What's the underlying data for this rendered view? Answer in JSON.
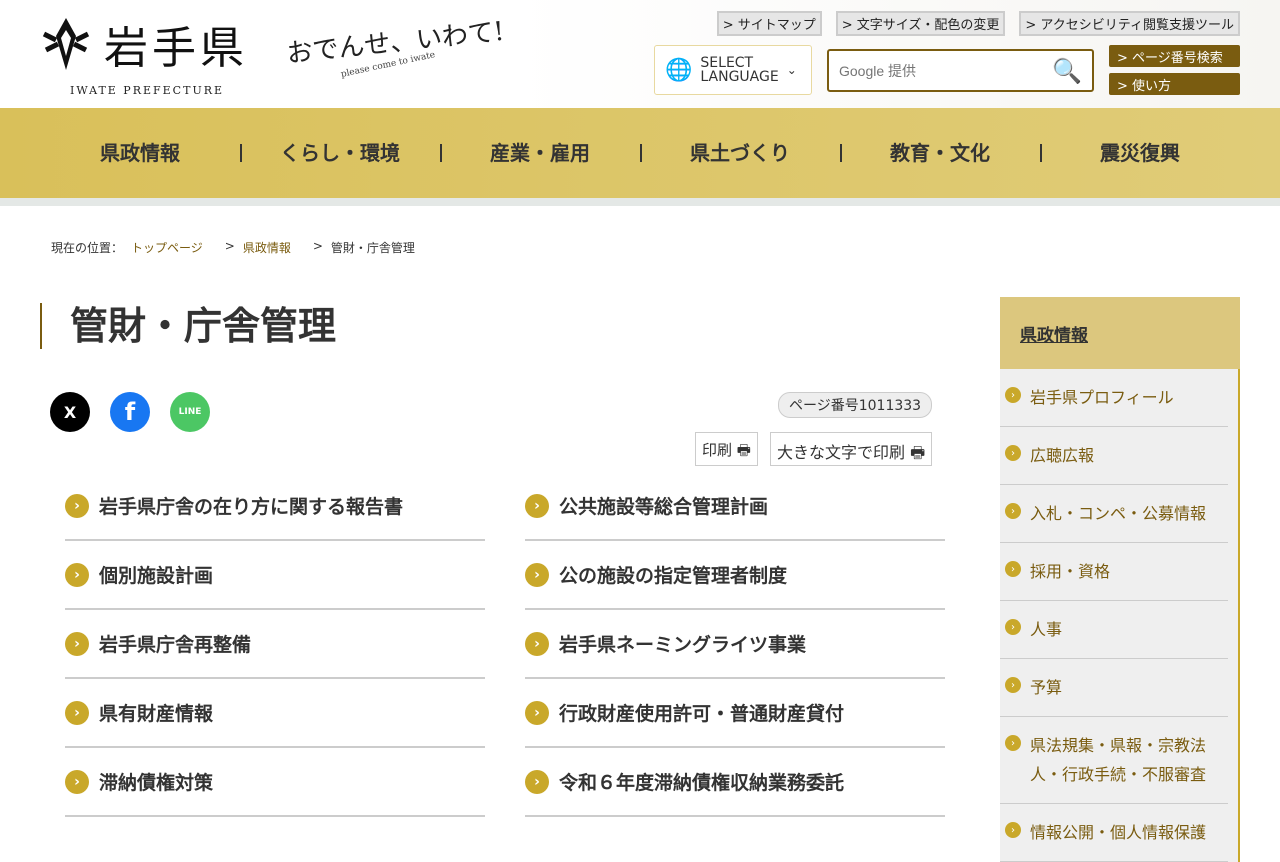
{
  "header": {
    "logo_text": "岩手県",
    "logo_sub": "IWATE PREFECTURE",
    "catch": "おでんせ、いわて!",
    "catch_sub": "please come to iwate",
    "toplinks": [
      "> サイトマップ",
      "> 文字サイズ・配色の変更",
      "> アクセシビリティ閲覧支援ツール"
    ],
    "lang_line1": "SELECT",
    "lang_line2": "LANGUAGE",
    "search_placeholder": "Google 提供",
    "page_search": "> ページ番号検索",
    "howto": "> 使い方"
  },
  "nav": [
    "県政情報",
    "くらし・環境",
    "産業・雇用",
    "県土づくり",
    "教育・文化",
    "震災復興"
  ],
  "breadcrumb": {
    "label": "現在の位置：",
    "items": [
      "トップページ",
      "県政情報"
    ],
    "current": "管財・庁舎管理",
    "sep": ">"
  },
  "page": {
    "title": "管財・庁舎管理",
    "page_number": "ページ番号1011333",
    "print": "印刷",
    "print_large": "大きな文字で印刷"
  },
  "social": {
    "x": "X",
    "facebook": "f",
    "line": "LINE"
  },
  "links": [
    "岩手県庁舎の在り方に関する報告書",
    "公共施設等総合管理計画",
    "個別施設計画",
    "公の施設の指定管理者制度",
    "岩手県庁舎再整備",
    "岩手県ネーミングライツ事業",
    "県有財産情報",
    "行政財産使用許可・普通財産貸付",
    "滞納債権対策",
    "令和６年度滞納債権収納業務委託"
  ],
  "sidebar": {
    "heading": "県政情報",
    "items": [
      "岩手県プロフィール",
      "広聴広報",
      "入札・コンペ・公募情報",
      "採用・資格",
      "人事",
      "予算",
      "県法規集・県報・宗教法人・行政手続・不服審査",
      "情報公開・個人情報保護"
    ]
  }
}
